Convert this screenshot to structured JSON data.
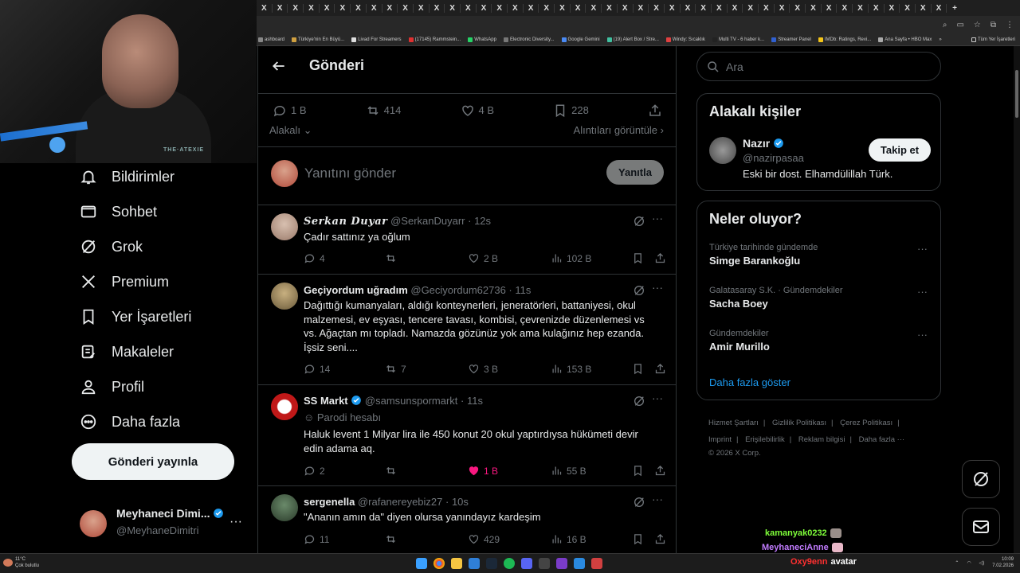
{
  "browser": {
    "tab_count": 44,
    "tab_label": "X",
    "bookmarks": [
      {
        "label": "ashboard",
        "color": "#888888"
      },
      {
        "label": "Türkiye'nin En Büyü...",
        "color": "#d0a040"
      },
      {
        "label": "Livad For Streamers",
        "color": "#dddddd"
      },
      {
        "label": "(17145) Rammstein...",
        "color": "#e03030"
      },
      {
        "label": "WhatsApp",
        "color": "#25d366"
      },
      {
        "label": "Electronic Diversity...",
        "color": "#777777"
      },
      {
        "label": "Google Gemini",
        "color": "#4a8af4"
      },
      {
        "label": "(19) Alert Box / Stre...",
        "color": "#40c0a0"
      },
      {
        "label": "Windy: Sıcaklık",
        "color": "#e04040"
      },
      {
        "label": "Multi TV - 6 haber k...",
        "color": "#222222"
      },
      {
        "label": "Streamer Panel",
        "color": "#3060d0"
      },
      {
        "label": "IMDb: Ratings, Revi...",
        "color": "#f5c518"
      },
      {
        "label": "Ana Sayfa • HBO Max",
        "color": "#aaaaaa"
      }
    ],
    "bookmarks_overflow": "»",
    "all_bookmarks": "Tüm Yer İşaretleri"
  },
  "webcam": {
    "logo": "THE·ATEXIE"
  },
  "nav": {
    "items": [
      {
        "label": "Bildirimler",
        "icon": "bell-icon"
      },
      {
        "label": "Sohbet",
        "icon": "mail-icon"
      },
      {
        "label": "Grok",
        "icon": "grok-icon"
      },
      {
        "label": "Premium",
        "icon": "x-logo-icon"
      },
      {
        "label": "Yer İşaretleri",
        "icon": "bookmark-icon"
      },
      {
        "label": "Makaleler",
        "icon": "article-icon"
      },
      {
        "label": "Profil",
        "icon": "person-icon"
      },
      {
        "label": "Daha fazla",
        "icon": "more-circle-icon"
      }
    ],
    "post_button": "Gönderi yayınla",
    "account": {
      "name": "Meyhaneci Dimi...",
      "handle": "@MeyhaneDimitri",
      "more": "···"
    }
  },
  "main": {
    "title": "Gönderi",
    "stats": {
      "replies": "1 B",
      "reposts": "414",
      "likes": "4 B",
      "bookmarks": "228"
    },
    "filter_label": "Alakalı",
    "quotes_link": "Alıntıları görüntüle",
    "reply_placeholder": "Yanıtını gönder",
    "reply_button": "Yanıtla",
    "tweets": [
      {
        "name": "Serkan Duyar",
        "handle": "@SerkanDuyarr",
        "time": "12s",
        "verified": false,
        "parody": "",
        "text": "Çadır sattınız ya oğlum",
        "replies": "4",
        "reposts": "",
        "likes": "2 B",
        "views": "102 B",
        "liked": false
      },
      {
        "name": "Geçiyordum uğradım",
        "handle": "@Geciyordum62736",
        "time": "11s",
        "verified": false,
        "parody": "",
        "text": "Dağıttığı kumanyaları, aldığı konteynerleri, jeneratörleri, battaniyesi, okul malzemesi, ev eşyası, tencere tavası, kombisi, çevrenizde düzenlemesi vs vs. Ağaçtan mı topladı. Namazda gözünüz yok ama kulağınız hep ezanda. İşsiz seni....",
        "replies": "14",
        "reposts": "7",
        "likes": "3 B",
        "views": "153 B",
        "liked": false
      },
      {
        "name": "SS Markt",
        "handle": "@samsunspormarkt",
        "time": "11s",
        "verified": true,
        "parody": "Parodi hesabı",
        "text": "Haluk levent 1 Milyar lira ile 450 konut 20 okul yaptırdıysa hükümeti devir edin adama aq.",
        "replies": "2",
        "reposts": "",
        "likes": "1 B",
        "views": "55 B",
        "liked": true
      },
      {
        "name": "sergenella",
        "handle": "@rafanereyebiz27",
        "time": "10s",
        "verified": false,
        "parody": "",
        "text": "\"Ananın amın da\" diyen olursa yanındayız kardeşim",
        "replies": "11",
        "reposts": "",
        "likes": "429",
        "views": "16 B",
        "liked": false
      }
    ]
  },
  "right": {
    "search_placeholder": "Ara",
    "related_title": "Alakalı kişiler",
    "related_person": {
      "name": "Nazır",
      "handle": "@nazirpasaa",
      "bio": "Eski bir dost. Elhamdülillah Türk.",
      "follow": "Takip et"
    },
    "trends_title": "Neler oluyor?",
    "trends": [
      {
        "context": "Türkiye tarihinde gündemde",
        "name": "Simge Barankoğlu"
      },
      {
        "context": "Galatasaray S.K. · Gündemdekiler",
        "name": "Sacha Boey"
      },
      {
        "context": "Gündemdekiler",
        "name": "Amir Murillo"
      }
    ],
    "show_more": "Daha fazla göster",
    "footer": {
      "links_row1": [
        "Hizmet Şartları",
        "Gizlilik Politikası",
        "Çerez Politikası"
      ],
      "links_row2": [
        "Imprint",
        "Erişilebilirlik",
        "Reklam bilgisi",
        "Daha fazla ···"
      ],
      "copyright": "© 2026 X Corp."
    }
  },
  "chat": [
    {
      "user": "kamanyak0232",
      "color": "#7fff3a"
    },
    {
      "user": "MeyhaneciAnne",
      "color": "#c27cff"
    },
    {
      "user": "Oxy9enn",
      "color": "#ff3030",
      "message": "avatar"
    }
  ],
  "taskbar": {
    "weather_temp": "11°C",
    "weather_desc": "Çok bulutlu",
    "time": "10:09",
    "date": "7.02.2026"
  }
}
